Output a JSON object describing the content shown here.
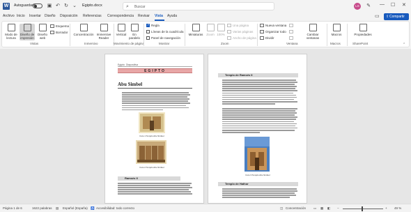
{
  "titlebar": {
    "autosave_label": "Autoguardado",
    "doc_name": "Egipto.docx",
    "search_placeholder": "Buscar",
    "avatar_initials": "LS"
  },
  "menu": {
    "tabs": [
      "Archivo",
      "Inicio",
      "Insertar",
      "Diseño",
      "Disposición",
      "Referencias",
      "Correspondencia",
      "Revisar",
      "Vista",
      "Ayuda"
    ],
    "active": "Vista",
    "share_label": "Compartir"
  },
  "ribbon": {
    "vistas": {
      "modo_lectura": "Modo de lectura",
      "diseno_impresion": "Diseño de impresión",
      "diseno_web": "Diseño web",
      "esquema": "Esquema",
      "borrador": "Borrador",
      "label": "Vistas"
    },
    "inmersivo": {
      "concentracion": "Concentración",
      "immersive_reader": "Immersive Reader",
      "label": "Inmersivo"
    },
    "movimiento": {
      "vertical": "Vertical",
      "en_paralelo": "En paralelo",
      "label": "Movimiento de página"
    },
    "mostrar": {
      "regla": "Regla",
      "lineas_cuadricula": "Líneas de la cuadrícula",
      "panel_navegacion": "Panel de navegación",
      "regla_checked": true,
      "label": "Mostrar"
    },
    "zoom": {
      "miniaturas": "Miniaturas",
      "zoom": "Zoom",
      "pct": "100%",
      "una_pagina": "Una página",
      "varias_paginas": "Varias páginas",
      "ancho_pagina": "Ancho de página",
      "label": "Zoom"
    },
    "ventana": {
      "nueva_ventana": "Nueva ventana",
      "organizar_todo": "Organizar todo",
      "dividir": "Dividir",
      "cambiar_ventanas": "Cambiar ventanas",
      "label": "Ventana"
    },
    "macros": {
      "macros": "Macros",
      "label": "Macros"
    },
    "sharepoint": {
      "propiedades": "Propiedades",
      "label": "SharePoint"
    }
  },
  "document": {
    "header_left": "Egipto",
    "header_right": "Diapositiva",
    "banner": "EGIPTO",
    "h1": "Abu Simbel",
    "caption1": "Foto 1 Templo Abu Simbel",
    "caption2": "Foto 2 Templo Abu Simbel",
    "section_ramses": "Ramsés II",
    "p2_title": "Templo de Ramsés II",
    "p2_caption": "Foto 3 Templo Abu Simbel",
    "p2_section_hathor": "Templo de Hathor"
  },
  "statusbar": {
    "page": "Página 1 de 6",
    "words": "1622 palabras",
    "language": "Español (España)",
    "accessibility": "Accesibilidad: todo correcto",
    "focus": "Concentración",
    "zoom": "49 %",
    "zoom_level_pct": 49
  }
}
